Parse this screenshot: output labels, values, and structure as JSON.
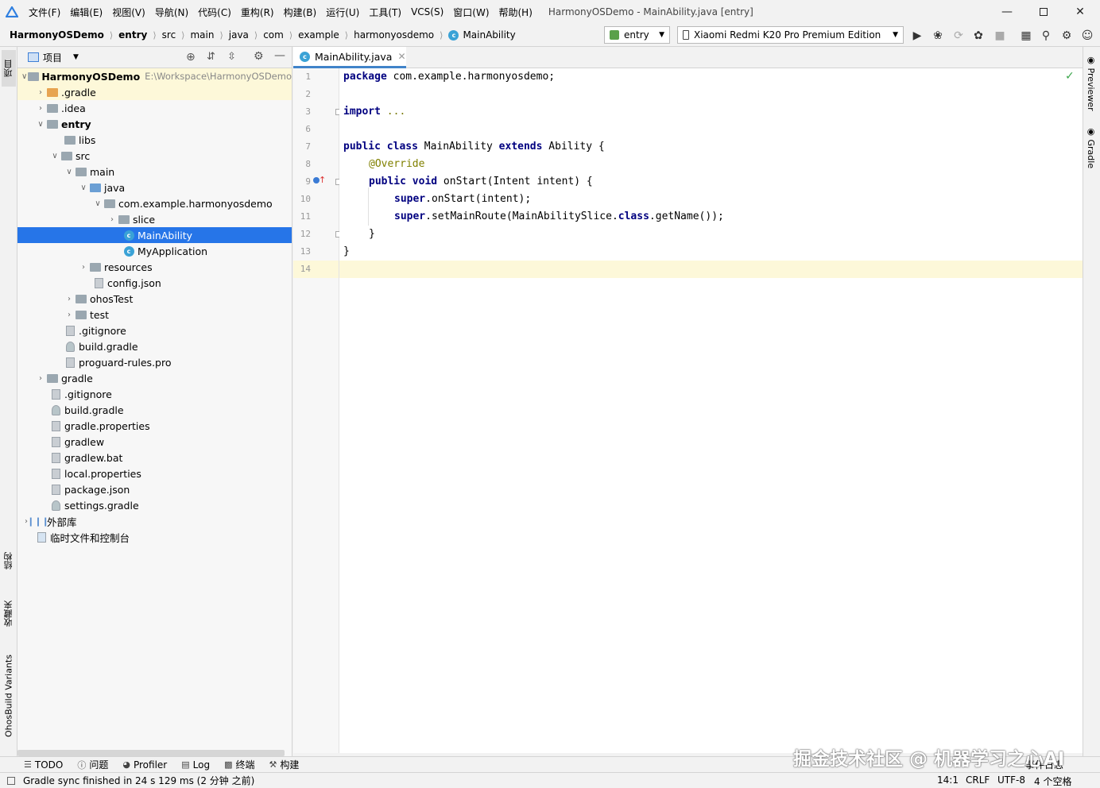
{
  "menubar": {
    "items": [
      "文件(F)",
      "编辑(E)",
      "视图(V)",
      "导航(N)",
      "代码(C)",
      "重构(R)",
      "构建(B)",
      "运行(U)",
      "工具(T)",
      "VCS(S)",
      "窗口(W)",
      "帮助(H)"
    ],
    "window_title": "HarmonyOSDemo - MainAbility.java [entry]"
  },
  "navbar": {
    "breadcrumbs": [
      "HarmonyOSDemo",
      "entry",
      "src",
      "main",
      "java",
      "com",
      "example",
      "harmonyosdemo",
      "MainAbility"
    ],
    "run_config": "entry",
    "device": "Xiaomi Redmi K20 Pro Premium Edition"
  },
  "left_stripe": {
    "project_tab": "项目",
    "structure_tab": "结构",
    "favorites_tab": "收藏夹",
    "build_variants_tab": "OhosBuild Variants"
  },
  "project_panel": {
    "title": "项目",
    "tree": [
      {
        "label": "HarmonyOSDemo",
        "path": "E:\\Workspace\\HarmonyOSDemo"
      },
      {
        "label": ".gradle"
      },
      {
        "label": ".idea"
      },
      {
        "label": "entry"
      },
      {
        "label": "libs"
      },
      {
        "label": "src"
      },
      {
        "label": "main"
      },
      {
        "label": "java"
      },
      {
        "label": "com.example.harmonyosdemo"
      },
      {
        "label": "slice"
      },
      {
        "label": "MainAbility"
      },
      {
        "label": "MyApplication"
      },
      {
        "label": "resources"
      },
      {
        "label": "config.json"
      },
      {
        "label": "ohosTest"
      },
      {
        "label": "test"
      },
      {
        "label": ".gitignore"
      },
      {
        "label": "build.gradle"
      },
      {
        "label": "proguard-rules.pro"
      },
      {
        "label": "gradle"
      },
      {
        "label": ".gitignore"
      },
      {
        "label": "build.gradle"
      },
      {
        "label": "gradle.properties"
      },
      {
        "label": "gradlew"
      },
      {
        "label": "gradlew.bat"
      },
      {
        "label": "local.properties"
      },
      {
        "label": "package.json"
      },
      {
        "label": "settings.gradle"
      },
      {
        "label": "外部库"
      },
      {
        "label": "临时文件和控制台"
      }
    ]
  },
  "editor": {
    "tab_label": "MainAbility.java",
    "line_numbers": [
      "1",
      "2",
      "3",
      "6",
      "7",
      "8",
      "9",
      "10",
      "11",
      "12",
      "13",
      "14"
    ],
    "code": {
      "l1_kw": "package",
      "l1_rest": " com.example.harmonyosdemo;",
      "l3_kw": "import",
      "l3_fold": " ...",
      "l7_kw1": "public class",
      "l7_name": " MainAbility ",
      "l7_kw2": "extends",
      "l7_rest": " Ability {",
      "l8_ann": "@Override",
      "l9_kw": "public void",
      "l9_rest": " onStart(Intent intent) {",
      "l10_kw": "super",
      "l10_rest": ".onStart(intent);",
      "l11_kw": "super",
      "l11_mid": ".setMainRoute(MainAbilitySlice.",
      "l11_kw2": "class",
      "l11_rest": ".getName());",
      "l12": "}",
      "l13": "}"
    }
  },
  "right_stripe": {
    "previewer": "Previewer",
    "gradle": "Gradle"
  },
  "bottom_tools": [
    "TODO",
    "问题",
    "Profiler",
    "Log",
    "终端",
    "构建"
  ],
  "event_log": "事件日志",
  "status": {
    "message": "Gradle sync finished in 24 s 129 ms (2 分钟 之前)",
    "position": "14:1",
    "line_sep": "CRLF",
    "encoding": "UTF-8",
    "indent": "4 个空格"
  },
  "watermark": "掘金技术社区 @ 机器学习之心AI"
}
